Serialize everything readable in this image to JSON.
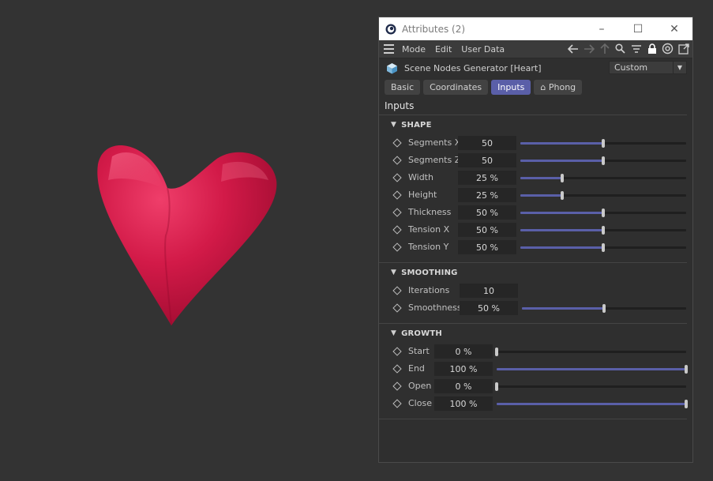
{
  "window": {
    "title": "Attributes (2)",
    "buttons": {
      "minimize": "–",
      "maximize": "☐",
      "close": "✕"
    }
  },
  "menu": {
    "items": [
      "Mode",
      "Edit",
      "User Data"
    ]
  },
  "toolbar": {
    "icons": [
      "back-arrow-icon",
      "forward-arrow-icon",
      "up-arrow-icon",
      "search-icon",
      "filter-icon",
      "lock-icon",
      "target-icon",
      "new-window-icon"
    ]
  },
  "object": {
    "name": "Scene Nodes Generator [Heart]",
    "preset": "Custom"
  },
  "tabs": [
    {
      "label": "Basic",
      "active": false
    },
    {
      "label": "Coordinates",
      "active": false
    },
    {
      "label": "Inputs",
      "active": true
    },
    {
      "label": "⌂ Phong",
      "active": false
    }
  ],
  "section": {
    "title": "Inputs"
  },
  "groups": {
    "shape": {
      "title": "SHAPE",
      "params": [
        {
          "label": "Segments X",
          "value": "50",
          "fraction": 0.5
        },
        {
          "label": "Segments Z",
          "value": "50",
          "fraction": 0.5
        },
        {
          "label": "Width",
          "value": "25 %",
          "fraction": 0.25
        },
        {
          "label": "Height",
          "value": "25 %",
          "fraction": 0.25
        },
        {
          "label": "Thickness",
          "value": "50 %",
          "fraction": 0.5
        },
        {
          "label": "Tension X",
          "value": "50 %",
          "fraction": 0.5
        },
        {
          "label": "Tension Y",
          "value": "50 %",
          "fraction": 0.5
        }
      ]
    },
    "smoothing": {
      "title": "SMOOTHING",
      "params": [
        {
          "label": "Iterations",
          "value": "10"
        },
        {
          "label": "Smoothness",
          "value": "50 %",
          "fraction": 0.5
        }
      ]
    },
    "growth": {
      "title": "GROWTH",
      "params": [
        {
          "label": "Start",
          "value": "0 %",
          "fraction": 0.0
        },
        {
          "label": "End",
          "value": "100 %",
          "fraction": 1.0
        },
        {
          "label": "Open",
          "value": "0 %",
          "fraction": 0.0
        },
        {
          "label": "Close",
          "value": "100 %",
          "fraction": 1.0
        }
      ]
    }
  },
  "colors": {
    "accent": "#5a5fa8",
    "heart": "#d41a4a"
  }
}
